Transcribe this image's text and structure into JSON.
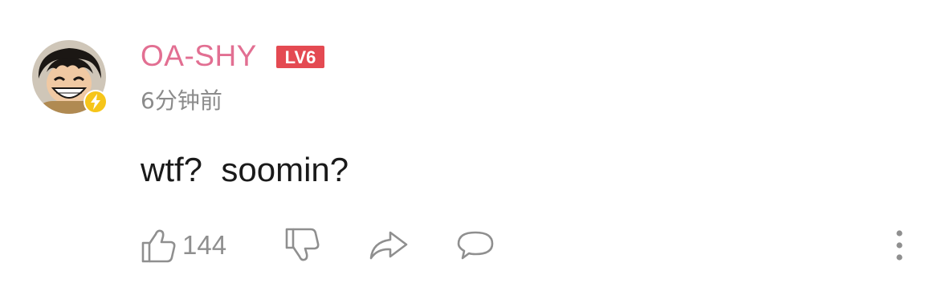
{
  "comment": {
    "username": "OA-SHY",
    "level": "LV6",
    "timestamp": "6分钟前",
    "content": "wtf?  soomin?",
    "like_count": "144"
  },
  "colors": {
    "username": "#e26f92",
    "level_badge": "#e44a52",
    "lightning_badge": "#f6c51a",
    "icon_gray": "#8f8f8f",
    "timestamp": "#8b8b8b",
    "text": "#1a1a1a"
  },
  "icons": {
    "verified_badge": "lightning-icon",
    "like": "thumbs-up-icon",
    "dislike": "thumbs-down-icon",
    "share": "share-arrow-icon",
    "reply": "speech-bubble-icon",
    "more": "vertical-dots-icon"
  }
}
